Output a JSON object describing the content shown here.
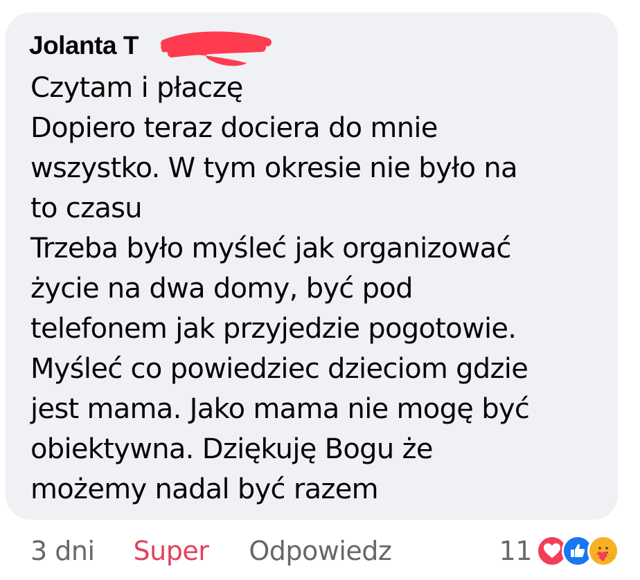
{
  "comment": {
    "author_name": "Jolanta T",
    "text": "Czytam i płaczę\nDopiero teraz dociera do mnie\nwszystko. W tym okresie nie było na\nto czasu\nTrzeba było myśleć jak organizować\nżycie na dwa domy, być pod\ntelefonem jak  przyjedzie pogotowie.\nMyśleć co powiedziec dzieciom gdzie\njest mama.  Jako mama nie mogę być\nobiektywna. Dziękuję Bogu że\nmożemy nadal być razem"
  },
  "actions": {
    "time": "3 dni",
    "like_label": "Super",
    "reply_label": "Odpowiedz"
  },
  "reactions": {
    "count": "11",
    "icons": [
      "love-reaction-icon",
      "like-reaction-icon",
      "care-reaction-icon"
    ]
  },
  "colors": {
    "bubble": "#eff1f4",
    "text": "#050505",
    "meta": "#65676b",
    "super_red": "#e4405a",
    "redaction": "#ff3b4f"
  }
}
